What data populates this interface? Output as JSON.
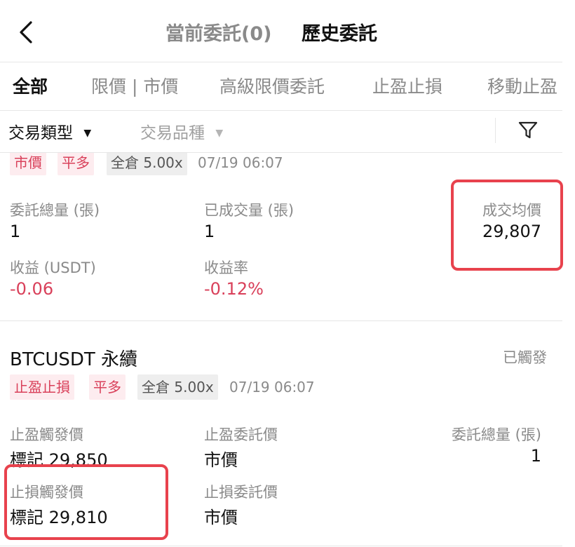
{
  "header": {
    "tab_current": "當前委託(0)",
    "tab_history": "歷史委託"
  },
  "subtabs": [
    {
      "label": "全部"
    },
    {
      "label": "限價 | 市價"
    },
    {
      "label": "高級限價委託"
    },
    {
      "label": "止盈止損"
    },
    {
      "label": "移動止盈"
    }
  ],
  "filters": {
    "type": "交易類型",
    "product": "交易品種"
  },
  "order1": {
    "tags": [
      "市價",
      "平多",
      "全倉 5.00x"
    ],
    "time": "07/19 06:07",
    "total_qty_label": "委託總量 (張)",
    "total_qty": "1",
    "filled_qty_label": "已成交量 (張)",
    "filled_qty": "1",
    "avg_price_label": "成交均價",
    "avg_price": "29,807",
    "pnl_label": "收益 (USDT)",
    "pnl": "-0.06",
    "pnl_rate_label": "收益率",
    "pnl_rate": "-0.12%"
  },
  "order2": {
    "symbol": "BTCUSDT 永續",
    "status": "已觸發",
    "tags": [
      "止盈止損",
      "平多",
      "全倉 5.00x"
    ],
    "time": "07/19 06:07",
    "tp_trigger_label": "止盈觸發價",
    "tp_trigger": "標記 29,850",
    "tp_order_label": "止盈委託價",
    "tp_order": "市價",
    "total_qty_label": "委託總量 (張)",
    "total_qty": "1",
    "sl_trigger_label": "止損觸發價",
    "sl_trigger": "標記 29,810",
    "sl_order_label": "止損委託價",
    "sl_order": "市價"
  },
  "colors": {
    "negative": "#d9405a",
    "highlight": "#e8424d"
  }
}
